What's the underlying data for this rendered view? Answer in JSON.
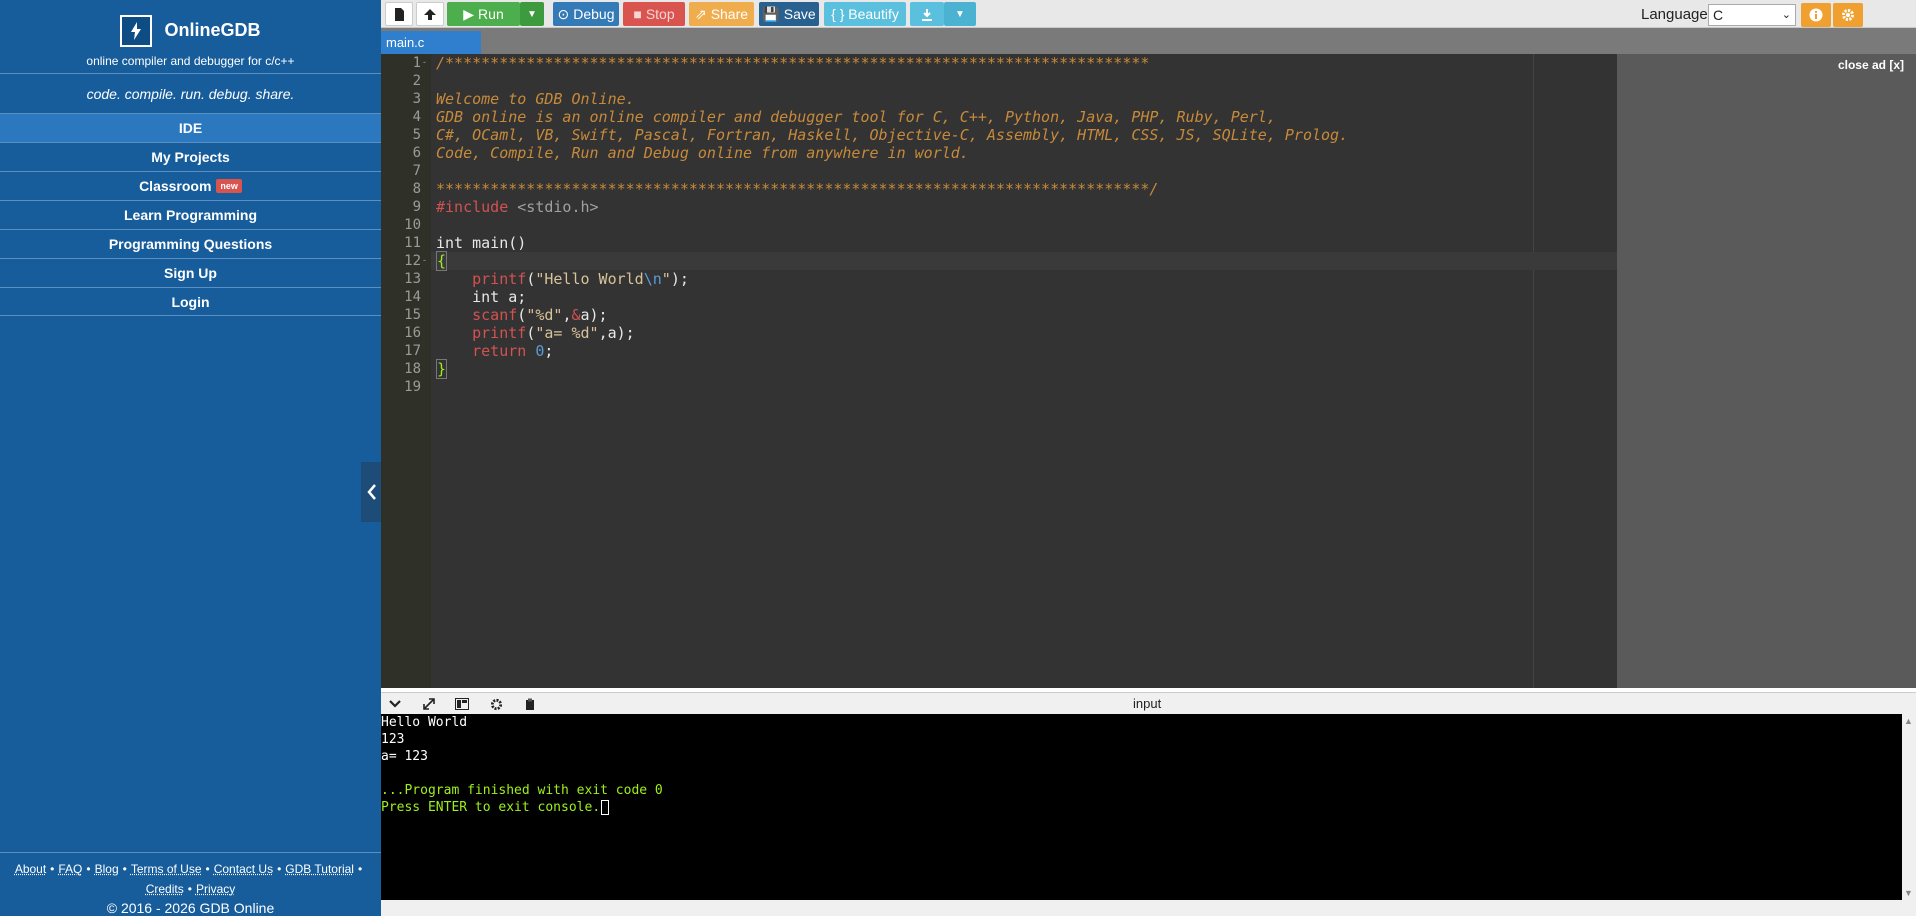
{
  "sidebar": {
    "brand_name": "OnlineGDB",
    "brand_sub": "online compiler and debugger for c/c++",
    "tagline": "code. compile. run. debug. share.",
    "nav": [
      {
        "label": "IDE"
      },
      {
        "label": "My Projects"
      },
      {
        "label": "Classroom",
        "badge": "new"
      },
      {
        "label": "Learn Programming"
      },
      {
        "label": "Programming Questions"
      },
      {
        "label": "Sign Up"
      },
      {
        "label": "Login"
      }
    ],
    "footer_links": [
      "About",
      "FAQ",
      "Blog",
      "Terms of Use",
      "Contact Us",
      "GDB Tutorial",
      "Credits",
      "Privacy"
    ],
    "copyright": "© 2016 - 2026 GDB Online"
  },
  "toolbar": {
    "run_label": "Run",
    "debug_label": "Debug",
    "stop_label": "Stop",
    "share_label": "Share",
    "save_label": "Save",
    "beautify_label": "{ } Beautify",
    "language_label": "Language",
    "language_value": "C"
  },
  "colors": {
    "run": "#4cae4c",
    "debug": "#337ab7",
    "stop": "#d9534f",
    "share": "#f0ad4e",
    "save": "#286090",
    "beautify": "#5bc0de",
    "download": "#5bc0de"
  },
  "editor": {
    "tab_name": "main.c",
    "line_numbers": [
      "1",
      "2",
      "3",
      "4",
      "5",
      "6",
      "7",
      "8",
      "9",
      "10",
      "11",
      "12",
      "13",
      "14",
      "15",
      "16",
      "17",
      "18",
      "19"
    ],
    "lines": {
      "l1": "/******************************************************************************",
      "l3": "Welcome to GDB Online.",
      "l4": "GDB online is an online compiler and debugger tool for C, C++, Python, Java, PHP, Ruby, Perl,",
      "l5": "C#, OCaml, VB, Swift, Pascal, Fortran, Haskell, Objective-C, Assembly, HTML, CSS, JS, SQLite, Prolog.",
      "l6": "Code, Compile, Run and Debug online from anywhere in world.",
      "l8": "*******************************************************************************/",
      "l9_kw": "#include",
      "l9_hdr": "<stdio.h>",
      "l11": "int main()",
      "l12": "{",
      "l13_fn": "printf",
      "l13_s1": "\"Hello World",
      "l13_esc": "\\n",
      "l13_s2": "\"",
      "l13_end": ");",
      "l14": "int a;",
      "l15_fn": "scanf",
      "l15_s": "\"%d\"",
      "l15_amp": "&",
      "l15_end": "a);",
      "l16_fn": "printf",
      "l16_s": "\"a= %d\"",
      "l16_end": ",a);",
      "l17_kw": "return",
      "l17_num": "0",
      "l17_end": ";",
      "l18": "}"
    },
    "close_ad": "close ad [x]"
  },
  "console": {
    "input_label": "input",
    "lines": [
      "Hello World",
      "123",
      "a= 123",
      "",
      "...Program finished with exit code 0",
      "Press ENTER to exit console."
    ]
  }
}
